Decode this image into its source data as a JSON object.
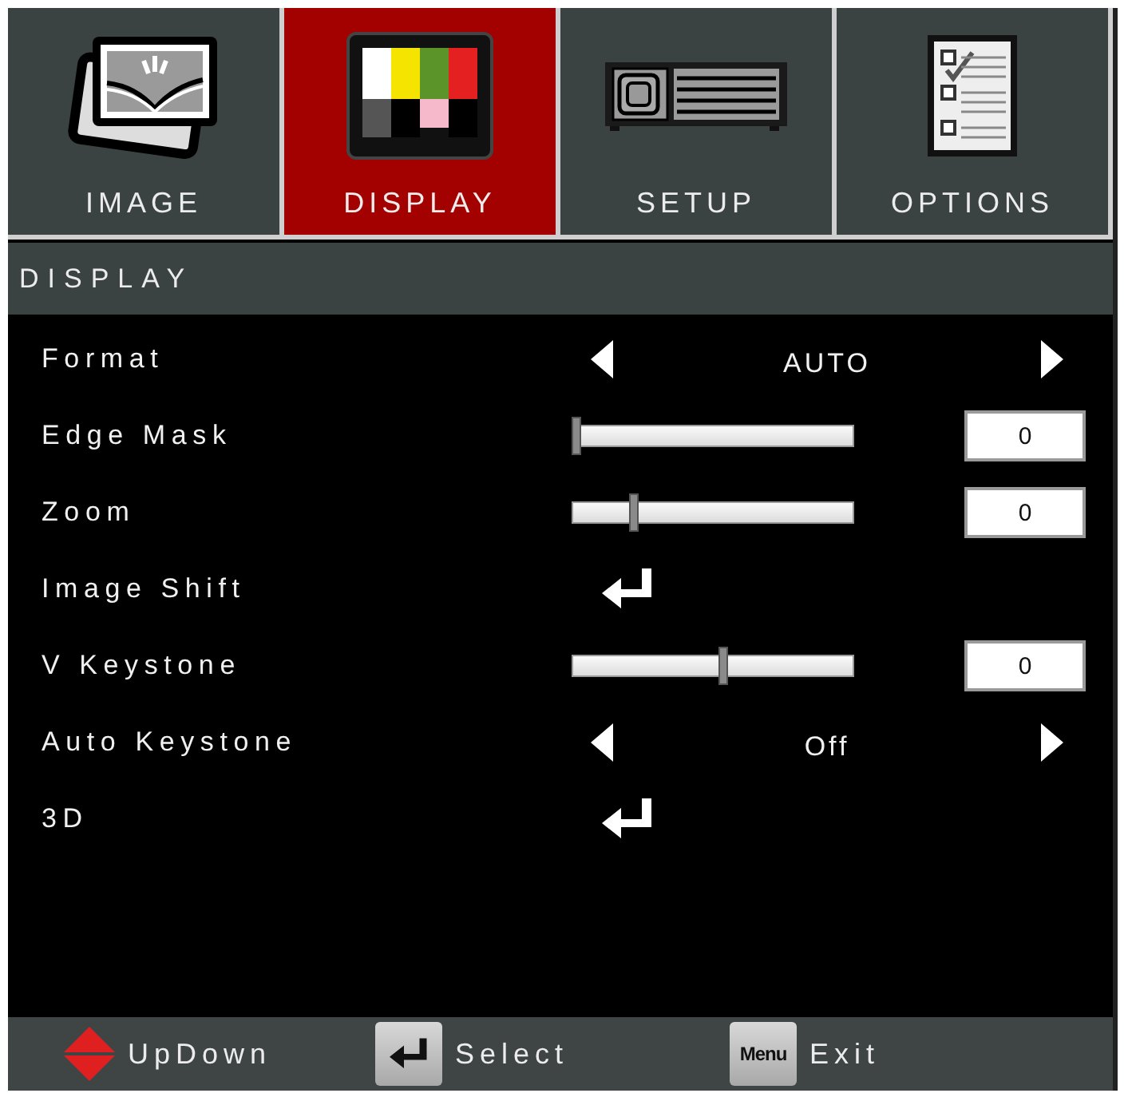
{
  "tabs": [
    {
      "label": "IMAGE",
      "selected": false
    },
    {
      "label": "DISPLAY",
      "selected": true
    },
    {
      "label": "SETUP",
      "selected": false
    },
    {
      "label": "OPTIONS",
      "selected": false
    }
  ],
  "section": {
    "title": "DISPLAY"
  },
  "rows": [
    {
      "label": "Format",
      "kind": "choice",
      "value": "AUTO"
    },
    {
      "label": "Edge Mask",
      "kind": "slider",
      "level": 0,
      "value": "0"
    },
    {
      "label": "Zoom",
      "kind": "slider",
      "level": 0.21,
      "value": "0"
    },
    {
      "label": "Image Shift",
      "kind": "submenu"
    },
    {
      "label": "V Keystone",
      "kind": "slider",
      "level": 0.54,
      "value": "0"
    },
    {
      "label": "Auto Keystone",
      "kind": "choice",
      "value": "Off"
    },
    {
      "label": "3D",
      "kind": "submenu"
    }
  ],
  "footer": [
    {
      "kind": "updown",
      "label": "UpDown"
    },
    {
      "kind": "enter",
      "label": "Select"
    },
    {
      "kind": "key",
      "key": "Menu",
      "label": "Exit"
    }
  ]
}
